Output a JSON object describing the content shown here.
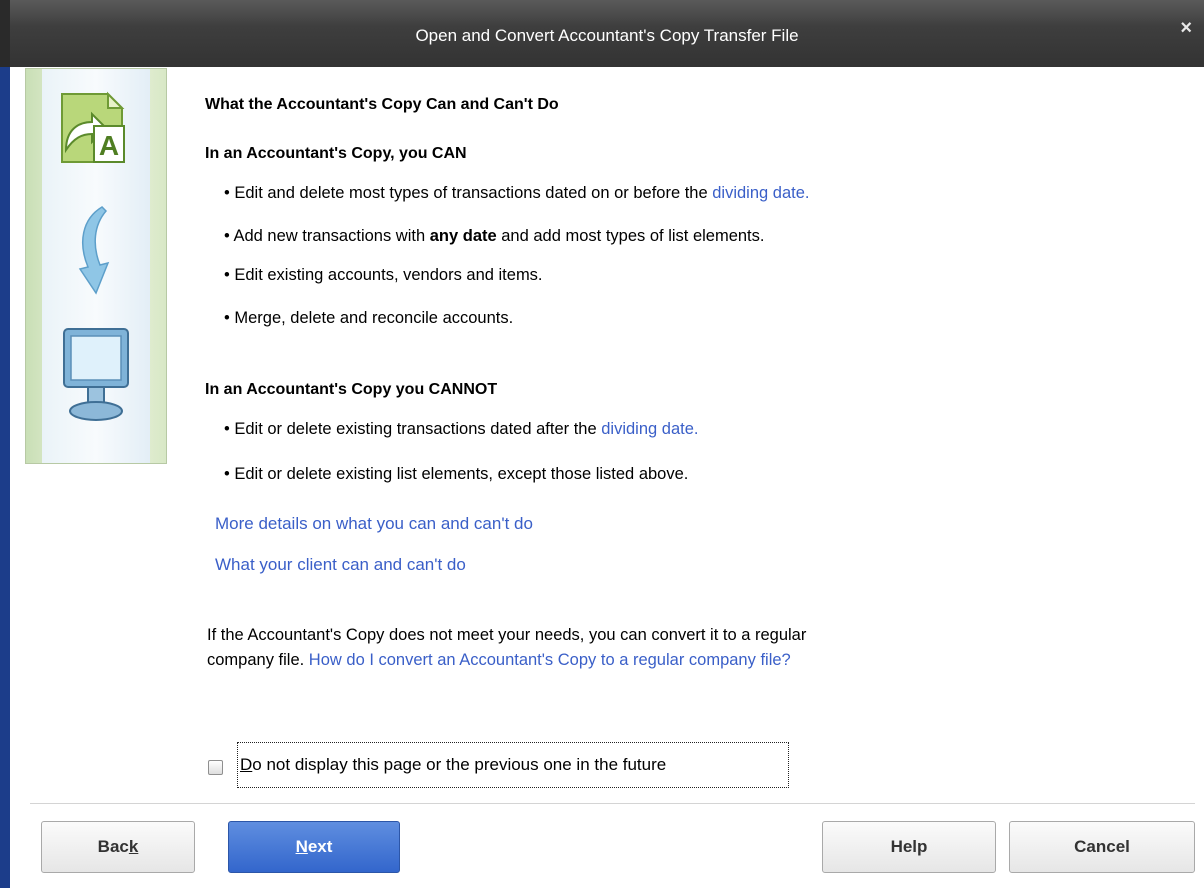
{
  "window": {
    "title": "Open and Convert Accountant's Copy Transfer File",
    "close_glyph": "×"
  },
  "main": {
    "heading": "What the Accountant's Copy Can and Can't Do",
    "can_section": {
      "title": "In an Accountant's Copy, you CAN",
      "items": [
        {
          "prefix": "• Edit and delete most types of transactions dated on or before the ",
          "link": "dividing date.",
          "bold": "",
          "suffix": ""
        },
        {
          "prefix": "• Add new transactions with ",
          "link": "",
          "bold": "any date",
          "suffix": " and add most types of list elements."
        },
        {
          "prefix": "• Edit existing accounts, vendors and items.",
          "link": "",
          "bold": "",
          "suffix": ""
        },
        {
          "prefix": "• Merge, delete and reconcile accounts.",
          "link": "",
          "bold": "",
          "suffix": ""
        }
      ]
    },
    "cannot_section": {
      "title": "In an Accountant's Copy you CANNOT",
      "items": [
        {
          "prefix": "• Edit or delete existing transactions dated after the ",
          "link": "dividing date."
        },
        {
          "prefix": "• Edit or delete existing list elements, except those listed above.",
          "link": ""
        }
      ]
    },
    "links": {
      "more_details": "More details on what you can and can't do",
      "client": "What your client can and can't do"
    },
    "convert_note": {
      "line1": "If the Accountant's Copy does not meet your needs, you can convert it to a regular",
      "line2_prefix": "company file. ",
      "line2_link": "How do I convert an Accountant's Copy to a regular company file?"
    },
    "checkbox": {
      "label_first": "D",
      "label_rest": "o not display this page or the previous one in the future",
      "checked": false
    }
  },
  "buttons": {
    "back_pre": "Bac",
    "back_u": "k",
    "next_u": "N",
    "next_post": "ext",
    "help": "Help",
    "cancel": "Cancel"
  },
  "colors": {
    "link": "#3a5fc8",
    "titlebar": "#3e3e3e",
    "primary_button": "#3366cc"
  },
  "icons": {
    "sidebar": [
      "convert-file-icon",
      "down-arrow-icon",
      "monitor-icon"
    ]
  }
}
